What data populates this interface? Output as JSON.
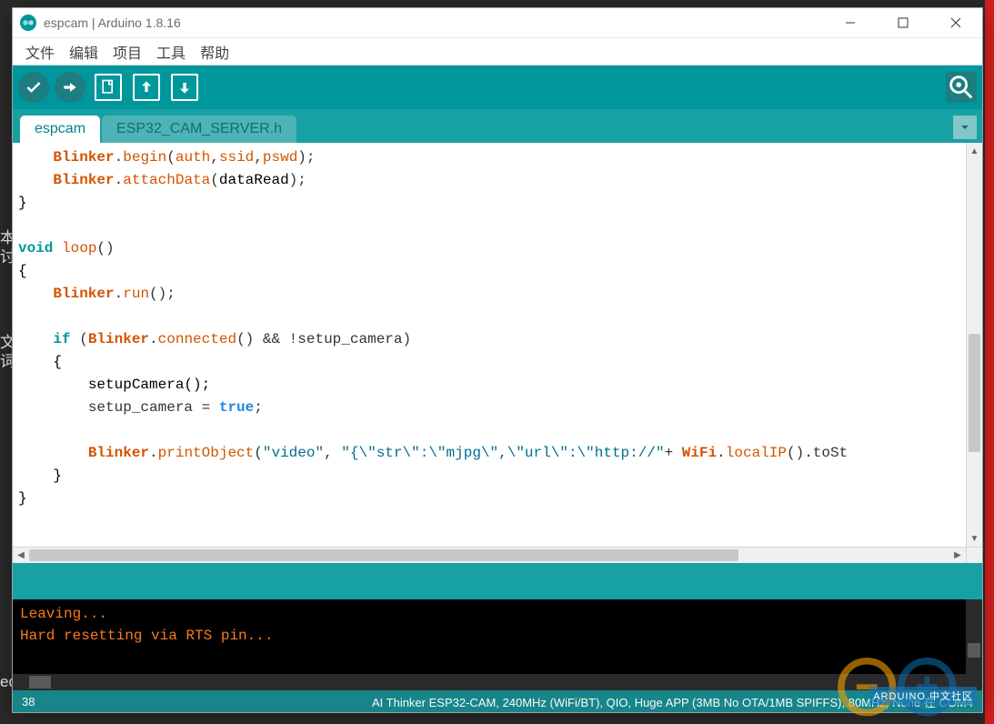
{
  "window": {
    "title": "espcam | Arduino 1.8.16"
  },
  "menu": {
    "file": "文件",
    "edit": "编辑",
    "sketch": "项目",
    "tools": "工具",
    "help": "帮助"
  },
  "tabs": {
    "active": "espcam",
    "other1": "ESP32_CAM_SERVER.h"
  },
  "code": {
    "lines": [
      {
        "type": "stmt",
        "indent": 1,
        "chunks": [
          [
            "klass",
            "Blinker"
          ],
          [
            "pun",
            "."
          ],
          [
            "method",
            "begin"
          ],
          [
            "pun",
            "("
          ],
          [
            "arg",
            "auth"
          ],
          [
            "pun",
            ","
          ],
          [
            "arg",
            "ssid"
          ],
          [
            "pun",
            ","
          ],
          [
            "arg",
            "pswd"
          ],
          [
            "pun",
            ");"
          ]
        ]
      },
      {
        "type": "stmt",
        "indent": 1,
        "chunks": [
          [
            "klass",
            "Blinker"
          ],
          [
            "pun",
            "."
          ],
          [
            "method",
            "attachData"
          ],
          [
            "pun",
            "("
          ],
          [
            "fn",
            "dataRead"
          ],
          [
            "pun",
            ");"
          ]
        ]
      },
      {
        "type": "raw",
        "text": "}"
      },
      {
        "type": "blank"
      },
      {
        "type": "stmt",
        "indent": 0,
        "chunks": [
          [
            "kw",
            "void"
          ],
          [
            "pun",
            " "
          ],
          [
            "method",
            "loop"
          ],
          [
            "pun",
            "()"
          ]
        ]
      },
      {
        "type": "raw",
        "text": "{"
      },
      {
        "type": "stmt",
        "indent": 1,
        "chunks": [
          [
            "klass",
            "Blinker"
          ],
          [
            "pun",
            "."
          ],
          [
            "method",
            "run"
          ],
          [
            "pun",
            "();"
          ]
        ]
      },
      {
        "type": "blank"
      },
      {
        "type": "stmt",
        "indent": 1,
        "chunks": [
          [
            "kw",
            "if"
          ],
          [
            "pun",
            " ("
          ],
          [
            "klass",
            "Blinker"
          ],
          [
            "pun",
            "."
          ],
          [
            "method",
            "connected"
          ],
          [
            "pun",
            "() && !setup_camera)"
          ]
        ]
      },
      {
        "type": "raw",
        "text": "    {"
      },
      {
        "type": "raw",
        "text": "        setupCamera();"
      },
      {
        "type": "stmt",
        "indent": 2,
        "chunks": [
          [
            "pun",
            "setup_camera = "
          ],
          [
            "const",
            "true"
          ],
          [
            "pun",
            ";"
          ]
        ]
      },
      {
        "type": "blank"
      },
      {
        "type": "stmt",
        "indent": 2,
        "chunks": [
          [
            "klass",
            "Blinker"
          ],
          [
            "pun",
            "."
          ],
          [
            "method",
            "printObject"
          ],
          [
            "pun",
            "("
          ],
          [
            "str",
            "\"video\""
          ],
          [
            "pun",
            ", "
          ],
          [
            "str",
            "\"{\\\"str\\\":\\\"mjpg\\\",\\\"url\\\":\\\"http://\""
          ],
          [
            "pun",
            "+ "
          ],
          [
            "klass",
            "WiFi"
          ],
          [
            "pun",
            "."
          ],
          [
            "method",
            "localIP"
          ],
          [
            "pun",
            "().toSt"
          ]
        ]
      },
      {
        "type": "raw",
        "text": "    }"
      },
      {
        "type": "raw",
        "text": "}"
      }
    ]
  },
  "console": {
    "l1": "Leaving...",
    "l2": "Hard resetting via RTS pin..."
  },
  "status": {
    "line": "38",
    "right": "AI Thinker ESP32-CAM, 240MHz (WiFi/BT), QIO, Huge APP (3MB No OTA/1MB SPIFFS), 80MHz, None 在 COM4"
  },
  "bg": {
    "h1": "本",
    "h2": "讨",
    "h3": "文",
    "h4": "词",
    "h5": "ed"
  },
  "watermark": "ARDUINO 中文社区"
}
